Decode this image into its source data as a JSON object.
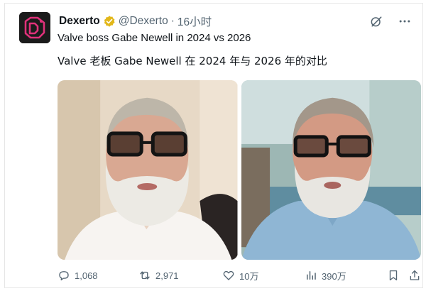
{
  "author": {
    "display_name": "Dexerto",
    "handle": "@Dexerto",
    "separator": "·",
    "time": "16小时",
    "avatar_icon": "dexerto-logo-icon",
    "verified_icon": "verified-badge-icon"
  },
  "tweet": {
    "text": "Valve boss Gabe Newell in 2024 vs 2026",
    "translation": "Valve 老板 Gabe Newell 在 2024 年与 2026 年的对比"
  },
  "media": {
    "images": [
      {
        "icon": "photo-2024"
      },
      {
        "icon": "photo-2026"
      }
    ]
  },
  "actions": {
    "replies": "1,068",
    "reposts": "2,971",
    "likes": "10万",
    "views": "390万"
  },
  "colors": {
    "text": "#0f1419",
    "muted": "#536471",
    "verified": "#e2b719",
    "avatar_bg": "#1b1b1b",
    "avatar_logo": "#e0317a"
  }
}
